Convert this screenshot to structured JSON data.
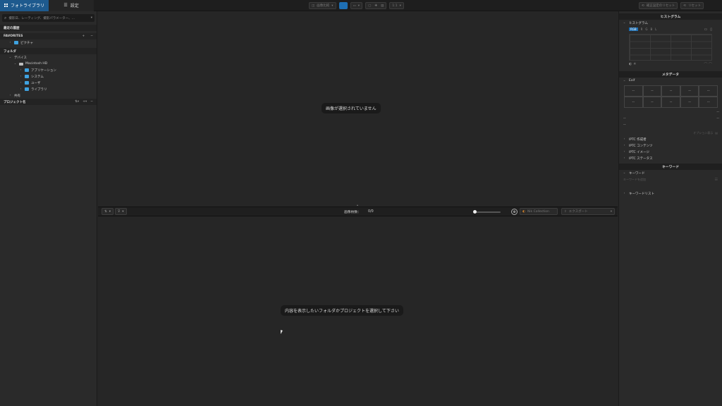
{
  "topbar": {
    "tabs": [
      {
        "label": "フォトライブラリ",
        "icon": "grid-icon"
      },
      {
        "label": "設定",
        "icon": "sliders-icon"
      }
    ],
    "center_buttons": {
      "compare_label": "画像比較",
      "zoom_label": "1:1"
    },
    "right_buttons": {
      "reset_settings_label": "補正設定のリセット",
      "reset_label": "リセット"
    }
  },
  "left": {
    "search_placeholder": "撮影日、レーティング、撮影パラメーター、…",
    "recent_label": "最近の履歴",
    "favorites_label": "FAVORITES",
    "favorites_items": [
      {
        "label": "ピクチャ"
      }
    ],
    "folders_label": "フォルダ",
    "devices_label": "デバイス",
    "disk_label": "Macintosh HD",
    "disk_children": [
      {
        "label": "アプリケーション"
      },
      {
        "label": "システム"
      },
      {
        "label": "ユーザ"
      },
      {
        "label": "ライブラリ"
      }
    ],
    "shared_label": "共有",
    "projects_label": "プロジェクト名"
  },
  "center": {
    "no_image_message": "画像が選択されていません",
    "image_count_label": "画像枚数：",
    "image_count_value": "0/0",
    "collection_label": "Nik Collection",
    "export_label": "エクスポート",
    "browser_message": "内容を表示したいフォルダかプロジェクトを選択して下さい"
  },
  "right": {
    "histogram_header": "ヒストグラム",
    "histogram_section": "ヒストグラム",
    "histogram_modes": [
      "RGB",
      "R",
      "G",
      "B",
      "L"
    ],
    "metadata_header": "メタデータ",
    "exif_label": "Exif",
    "exif_placeholder": "--",
    "option_label": "オプション表示",
    "iptc_sections": [
      {
        "label": "IPTC 作成者"
      },
      {
        "label": "IPTC コンテンツ"
      },
      {
        "label": "IPTC イメージ"
      },
      {
        "label": "IPTC ステータス"
      }
    ],
    "keyword_header": "キーワード",
    "keyword_section": "キーワード",
    "keyword_placeholder": "キーワードを追加",
    "keyword_list_label": "キーワードリスト"
  },
  "colors": {
    "accent": "#1e5a8e",
    "folder": "#3fa2e0",
    "background": "#262626"
  }
}
